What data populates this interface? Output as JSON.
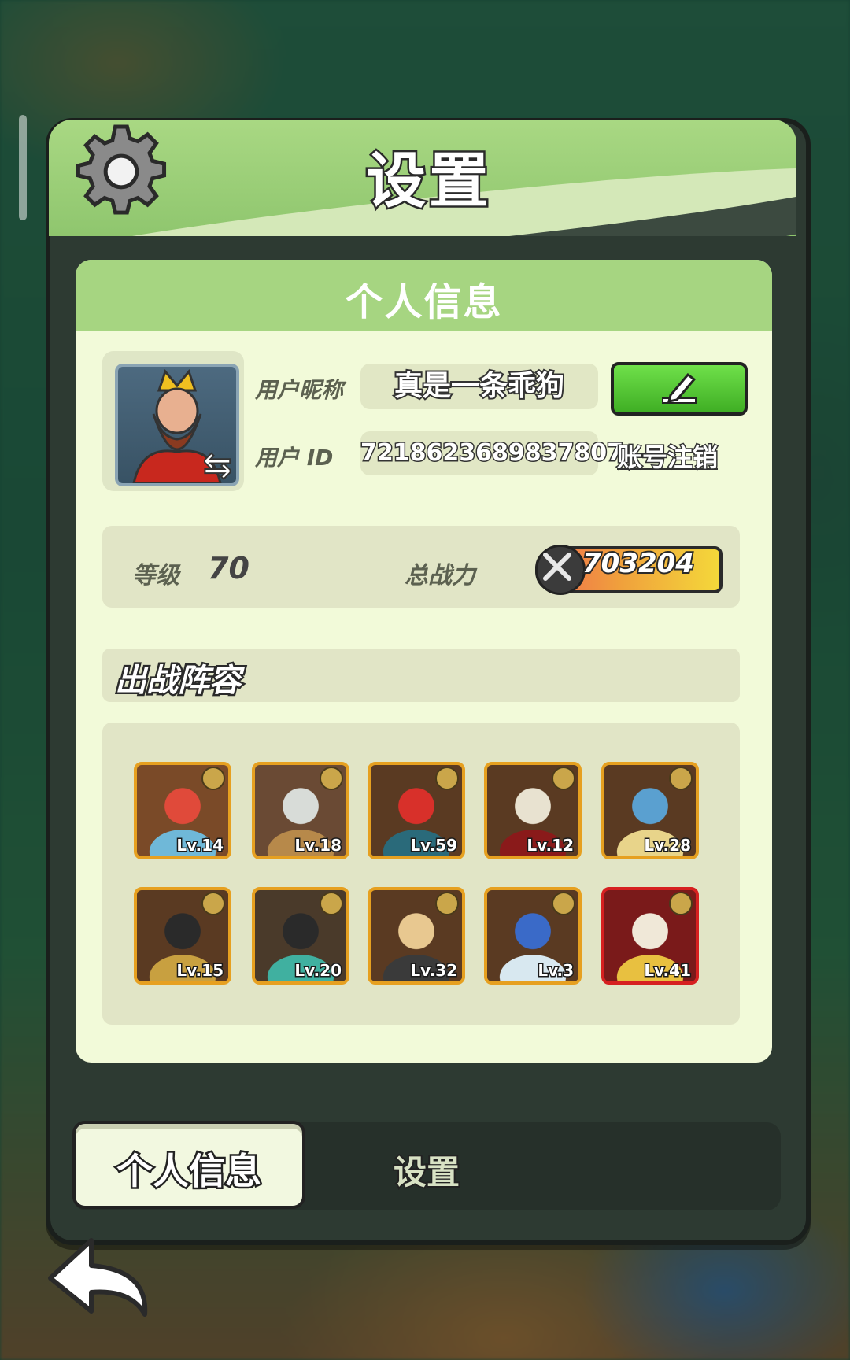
{
  "window": {
    "title": "设置"
  },
  "card": {
    "title": "个人信息"
  },
  "profile": {
    "nickname_label": "用户昵称",
    "nickname_value": "真是一条乖狗",
    "id_label": "用户 ID",
    "id_value": "7218623689837807",
    "cancel_account": "账号注销"
  },
  "stats": {
    "level_label": "等级",
    "level_value": "70",
    "power_label": "总战力",
    "power_value": "703204"
  },
  "lineup": {
    "title": "出战阵容",
    "heroes": [
      {
        "level": "Lv.14",
        "palette": "#7a4a28,#e04a3a,#6fb8d8"
      },
      {
        "level": "Lv.18",
        "palette": "#6a4a34,#d8dcd8,#b7894a"
      },
      {
        "level": "Lv.59",
        "palette": "#5a3a22,#d8302a,#2a6a7a"
      },
      {
        "level": "Lv.12",
        "palette": "#5a3a22,#e8e2d0,#8a1a1a"
      },
      {
        "level": "Lv.28",
        "palette": "#5a3a22,#5aa0d0,#e8d48a"
      },
      {
        "level": "Lv.15",
        "palette": "#5a3a22,#2a2a2a,#c8a040"
      },
      {
        "level": "Lv.20",
        "palette": "#4a3a2a,#2a2a2a,#40b0a0"
      },
      {
        "level": "Lv.32",
        "palette": "#5a3a22,#e8c890,#3a3a3a"
      },
      {
        "level": "Lv.3",
        "palette": "#5a3a22,#3a6ac8,#d8e8f0"
      },
      {
        "level": "Lv.41",
        "palette": "#7a1a1a,#f0e8d8,#e8c040",
        "rarity": "red"
      }
    ]
  },
  "tabs": {
    "profile": "个人信息",
    "settings": "设置"
  },
  "colors": {
    "header_green": "#a6d581",
    "card_bg": "#f2fad9",
    "edit_green": "#4fc02f",
    "border_gold": "#e6a020"
  }
}
